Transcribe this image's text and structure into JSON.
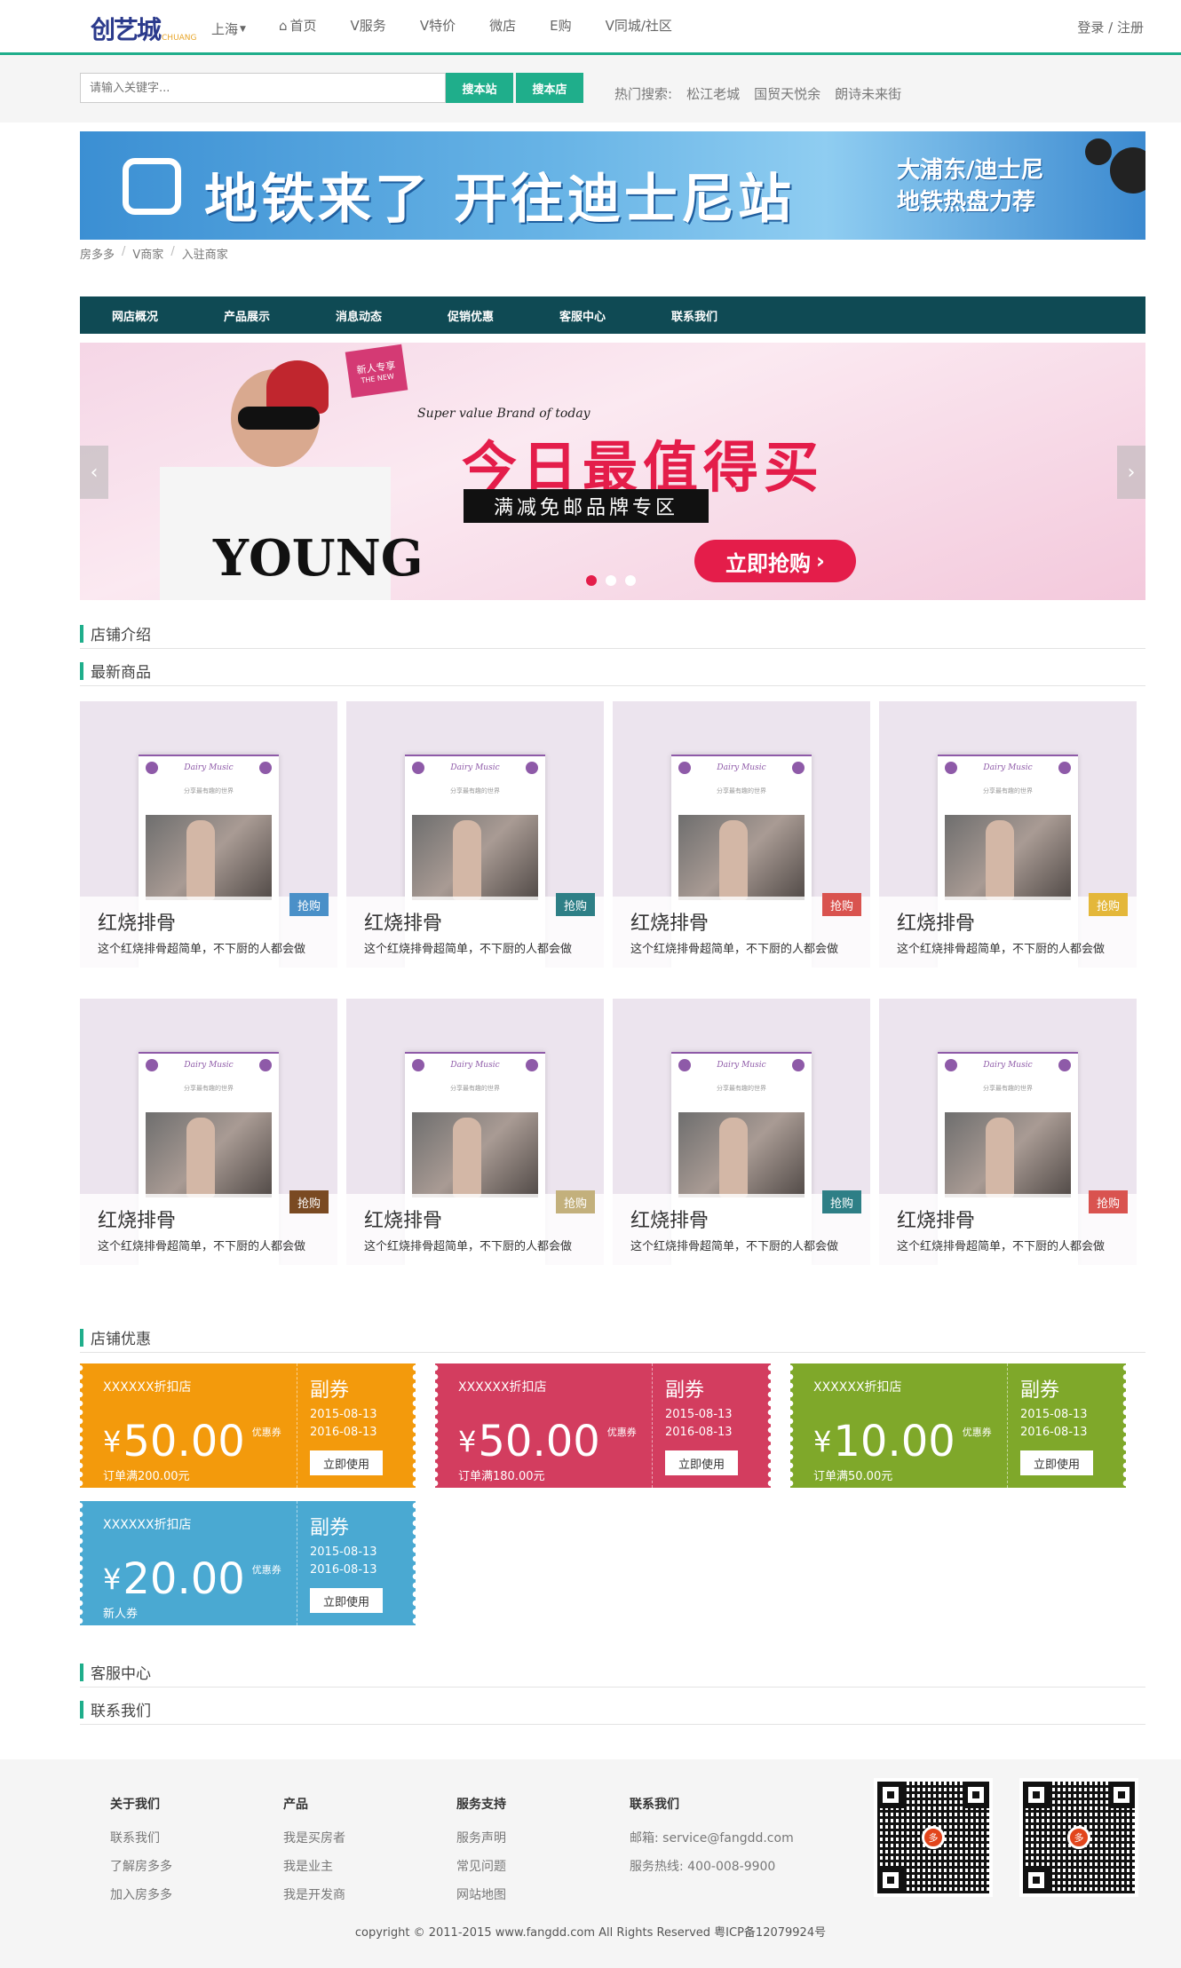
{
  "header": {
    "logo_text": "创艺城",
    "logo_sub": "CHUANG",
    "city": "上海",
    "nav": [
      {
        "label": "首页",
        "icon": "home-icon"
      },
      {
        "label": "V服务"
      },
      {
        "label": "V特价"
      },
      {
        "label": "微店"
      },
      {
        "label": "E购"
      },
      {
        "label": "V同城/社区"
      }
    ],
    "login": "登录 / 注册"
  },
  "search": {
    "placeholder": "请输入关键字...",
    "btn_site": "搜本站",
    "btn_store": "搜本店",
    "hot_label": "热门搜索:",
    "hot_terms": [
      "松江老城",
      "国贸天悦余",
      "朗诗未来街"
    ]
  },
  "banner": {
    "main": "地铁来了 开往迪士尼站",
    "side_line1": "大浦东/迪士尼",
    "side_line2": "地铁热盘力荐"
  },
  "breadcrumb": [
    "房多多",
    "V商家",
    "入驻商家"
  ],
  "shop_nav": [
    "网店概况",
    "产品展示",
    "消息动态",
    "促销优惠",
    "客服中心",
    "联系我们"
  ],
  "slider": {
    "tag_line1": "新人专享",
    "tag_line2": "THE NEW",
    "script_text": "Super value Brand of today",
    "title": "今日最值得买",
    "subtitle": "满减免邮品牌专区",
    "cta": "立即抢购",
    "young_text": "YOUNG",
    "prev": "‹",
    "next": "›",
    "dot_count": 3,
    "active_dot": 0
  },
  "sections": {
    "intro": "店铺介绍",
    "latest": "最新商品",
    "discount": "店铺优惠",
    "service": "客服中心",
    "contact": "联系我们"
  },
  "products": [
    {
      "name": "红烧排骨",
      "desc": "这个红烧排骨超简单，不下厨的人都会做",
      "tag": "抢购",
      "tag_color": "#4a90c8",
      "phone_title": "Dairy Music",
      "phone_sub": "分享最有趣的世界"
    },
    {
      "name": "红烧排骨",
      "desc": "这个红烧排骨超简单，不下厨的人都会做",
      "tag": "抢购",
      "tag_color": "#2e7f86",
      "phone_title": "Dairy Music",
      "phone_sub": "分享最有趣的世界"
    },
    {
      "name": "红烧排骨",
      "desc": "这个红烧排骨超简单，不下厨的人都会做",
      "tag": "抢购",
      "tag_color": "#d9534f",
      "phone_title": "Dairy Music",
      "phone_sub": "分享最有趣的世界"
    },
    {
      "name": "红烧排骨",
      "desc": "这个红烧排骨超简单，不下厨的人都会做",
      "tag": "抢购",
      "tag_color": "#e4b73a",
      "phone_title": "Dairy Music",
      "phone_sub": "分享最有趣的世界"
    },
    {
      "name": "红烧排骨",
      "desc": "这个红烧排骨超简单，不下厨的人都会做",
      "tag": "抢购",
      "tag_color": "#7a4a22",
      "phone_title": "Dairy Music",
      "phone_sub": "分享最有趣的世界"
    },
    {
      "name": "红烧排骨",
      "desc": "这个红烧排骨超简单，不下厨的人都会做",
      "tag": "抢购",
      "tag_color": "#c3b07c",
      "phone_title": "Dairy Music",
      "phone_sub": "分享最有趣的世界"
    },
    {
      "name": "红烧排骨",
      "desc": "这个红烧排骨超简单，不下厨的人都会做",
      "tag": "抢购",
      "tag_color": "#2e7f86",
      "phone_title": "Dairy Music",
      "phone_sub": "分享最有趣的世界"
    },
    {
      "name": "红烧排骨",
      "desc": "这个红烧排骨超简单，不下厨的人都会做",
      "tag": "抢购",
      "tag_color": "#d9534f",
      "phone_title": "Dairy Music",
      "phone_sub": "分享最有趣的世界"
    }
  ],
  "coupons": [
    {
      "shop": "XXXXXX折扣店",
      "yen": "¥",
      "amount": "50.00",
      "unit": "优惠券",
      "cond": "订单满200.00元",
      "fu": "副券",
      "from": "2015-08-13",
      "to": "2016-08-13",
      "btn": "立即使用",
      "color": "#f39a0c"
    },
    {
      "shop": "XXXXXX折扣店",
      "yen": "¥",
      "amount": "50.00",
      "unit": "优惠券",
      "cond": "订单满180.00元",
      "fu": "副券",
      "from": "2015-08-13",
      "to": "2016-08-13",
      "btn": "立即使用",
      "color": "#d33d5f"
    },
    {
      "shop": "XXXXXX折扣店",
      "yen": "¥",
      "amount": "10.00",
      "unit": "优惠券",
      "cond": "订单满50.00元",
      "fu": "副券",
      "from": "2015-08-13",
      "to": "2016-08-13",
      "btn": "立即使用",
      "color": "#7fa82a"
    },
    {
      "shop": "XXXXXX折扣店",
      "yen": "¥",
      "amount": "20.00",
      "unit": "优惠券",
      "cond": "新人券",
      "fu": "副券",
      "from": "2015-08-13",
      "to": "2016-08-13",
      "btn": "立即使用",
      "color": "#4aa9d2"
    }
  ],
  "footer": {
    "cols": [
      {
        "title": "关于我们",
        "items": [
          "联系我们",
          "了解房多多",
          "加入房多多"
        ]
      },
      {
        "title": "产品",
        "items": [
          "我是买房者",
          "我是业主",
          "我是开发商"
        ]
      },
      {
        "title": "服务支持",
        "items": [
          "服务声明",
          "常见问题",
          "网站地图"
        ]
      },
      {
        "title": "联系我们",
        "items": [
          "邮箱: service@fangdd.com",
          "服务热线: 400-008-9900"
        ]
      }
    ],
    "qr_logo": "多",
    "copyright": "copyright © 2011-2015 www.fangdd.com All Rights Reserved 粤ICP备12079924号"
  }
}
